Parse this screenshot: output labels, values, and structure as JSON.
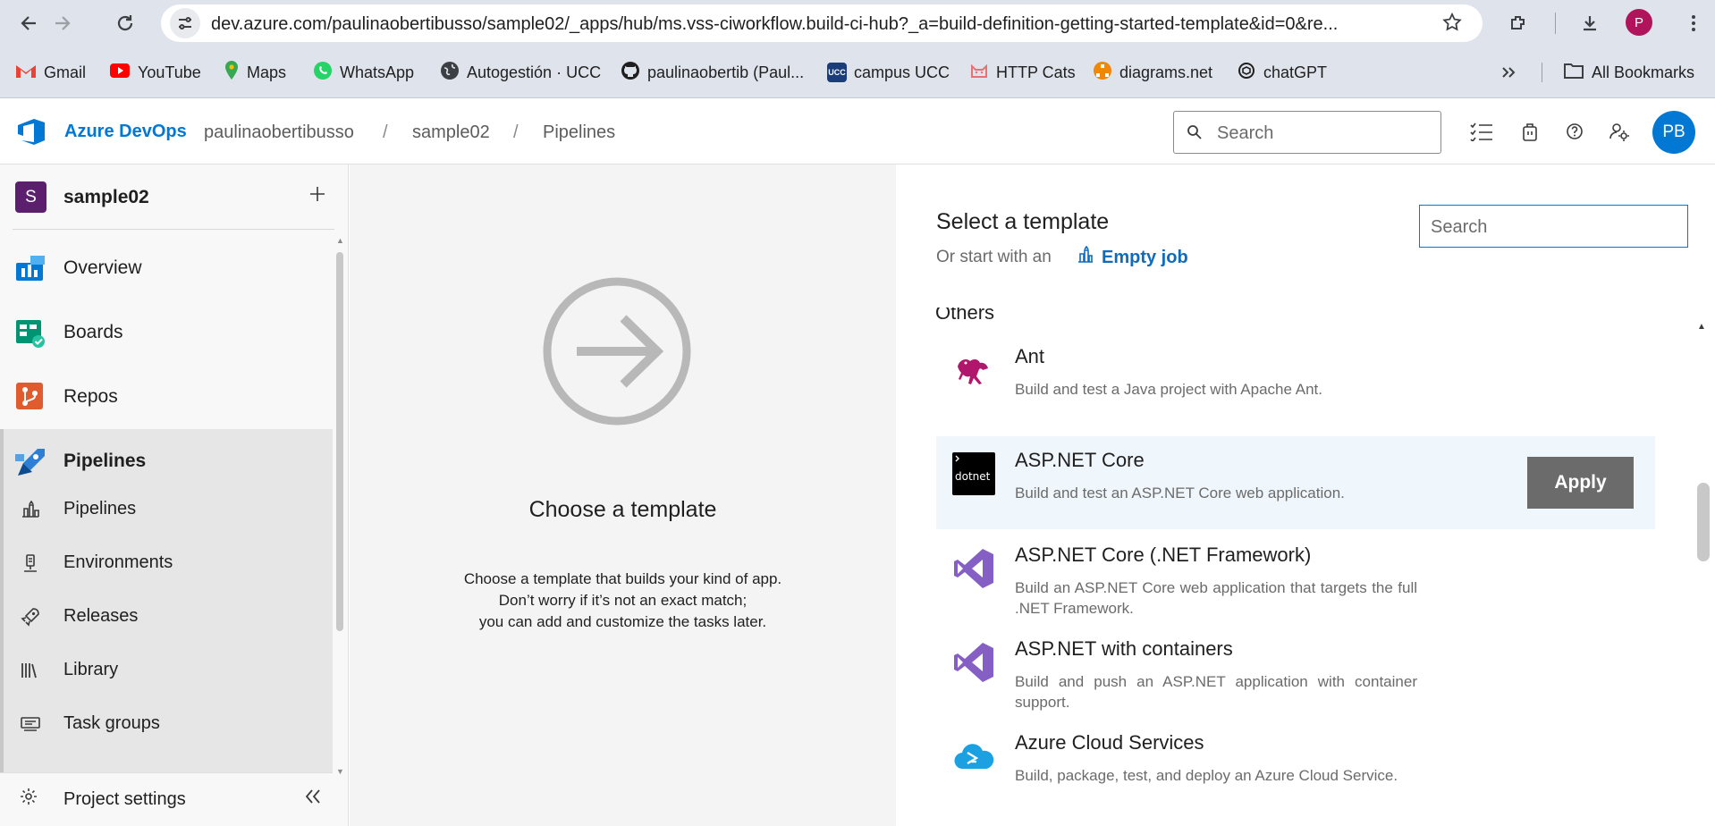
{
  "browser": {
    "url": "dev.azure.com/paulinaobertibusso/sample02/_apps/hub/ms.vss-ciworkflow.build-ci-hub?_a=build-definition-getting-started-template&id=0&re...",
    "profile_initial": "P",
    "bookmarks": [
      {
        "label": "Gmail",
        "icon": "gmail-icon",
        "color": "#ea4335"
      },
      {
        "label": "YouTube",
        "icon": "youtube-icon",
        "color": "#ff0000"
      },
      {
        "label": "Maps",
        "icon": "maps-icon",
        "color": "#34a853"
      },
      {
        "label": "WhatsApp",
        "icon": "whatsapp-icon",
        "color": "#25d366"
      },
      {
        "label": "Autogestión · UCC",
        "icon": "globe-icon",
        "color": "#3c4043"
      },
      {
        "label": "paulinaobertib (Paul...",
        "icon": "github-icon",
        "color": "#1f1f1f"
      },
      {
        "label": "campus UCC",
        "icon": "ucc-icon",
        "color": "#1a3c7a"
      },
      {
        "label": "HTTP Cats",
        "icon": "cat-icon",
        "color": "#e57373"
      },
      {
        "label": "diagrams.net",
        "icon": "diagrams-icon",
        "color": "#f08705"
      },
      {
        "label": "chatGPT",
        "icon": "chatgpt-icon",
        "color": "#1f1f1f"
      }
    ],
    "all_bookmarks": "All Bookmarks"
  },
  "header": {
    "brand": "Azure DevOps",
    "breadcrumbs": [
      "paulinaobertibusso",
      "sample02",
      "Pipelines"
    ],
    "search_placeholder": "Search",
    "user_initials": "PB",
    "accent": "#0078d4"
  },
  "sidebar": {
    "project_initial": "S",
    "project_name": "sample02",
    "items": [
      {
        "label": "Overview",
        "icon": "overview-icon"
      },
      {
        "label": "Boards",
        "icon": "boards-icon"
      },
      {
        "label": "Repos",
        "icon": "repos-icon"
      },
      {
        "label": "Pipelines",
        "icon": "pipelines-icon"
      }
    ],
    "sub_items": [
      {
        "label": "Pipelines",
        "icon": "pipelines-sub-icon"
      },
      {
        "label": "Environments",
        "icon": "environments-icon"
      },
      {
        "label": "Releases",
        "icon": "releases-icon"
      },
      {
        "label": "Library",
        "icon": "library-icon"
      },
      {
        "label": "Task groups",
        "icon": "task-groups-icon"
      }
    ],
    "settings_label": "Project settings"
  },
  "middle": {
    "title": "Choose a template",
    "desc_lines": [
      "Choose a template that builds your kind of app.",
      "Don’t worry if it’s not an exact match;",
      "you can add and customize the tasks later."
    ]
  },
  "templates_pane": {
    "title": "Select a template",
    "sub": "Or start with an",
    "empty_job": "Empty job",
    "search_placeholder": "Search",
    "section": "Others",
    "apply_label": "Apply",
    "templates": [
      {
        "name": "Ant",
        "desc": "Build and test a Java project with Apache Ant.",
        "logo": "ant-icon"
      },
      {
        "name": "ASP.NET Core",
        "desc": "Build and test an ASP.NET Core web application.",
        "logo": "dotnet-icon",
        "logo_text": "dotnet"
      },
      {
        "name": "ASP.NET Core (.NET Framework)",
        "desc": "Build an ASP.NET Core web application that targets the full .NET Framework.",
        "logo": "visual-studio-icon"
      },
      {
        "name": "ASP.NET with containers",
        "desc": "Build and push an ASP.NET application with container support.",
        "logo": "visual-studio-icon"
      },
      {
        "name": "Azure Cloud Services",
        "desc": "Build, package, test, and deploy an Azure Cloud Service.",
        "logo": "cloud-services-icon"
      }
    ]
  }
}
